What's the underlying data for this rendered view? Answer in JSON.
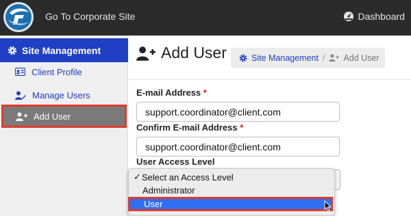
{
  "topbar": {
    "site_link": "Go To Corporate Site",
    "dashboard": "Dashboard"
  },
  "sidebar": {
    "header": "Site Management",
    "items": [
      {
        "label": "Client Profile",
        "icon": "id-card-icon"
      },
      {
        "label": "Manage Users",
        "icon": "user-edit-icon"
      },
      {
        "label": "Add User",
        "icon": "user-plus-icon",
        "active": true
      }
    ]
  },
  "main": {
    "title": "Add User",
    "breadcrumb": {
      "root": "Site Management",
      "separator": "/",
      "current": "Add User"
    },
    "fields": {
      "email_label": "E-mail Address",
      "email_value": "support.coordinator@client.com",
      "confirm_label": "Confirm E-mail Address",
      "confirm_value": "support.coordinator@client.com",
      "access_label": "User Access Level",
      "required_mark": "*"
    },
    "access_dropdown": {
      "options": [
        {
          "label": "Select an Access Level",
          "checked": true
        },
        {
          "label": "Administrator",
          "checked": false
        },
        {
          "label": "User",
          "highlighted": true
        }
      ],
      "check_mark": "✓"
    }
  },
  "colors": {
    "brand_blue": "#1f40c4",
    "topbar_bg": "#2b2b2b",
    "highlight_red": "#e03a2d",
    "selection_blue": "#2f6ff2"
  }
}
